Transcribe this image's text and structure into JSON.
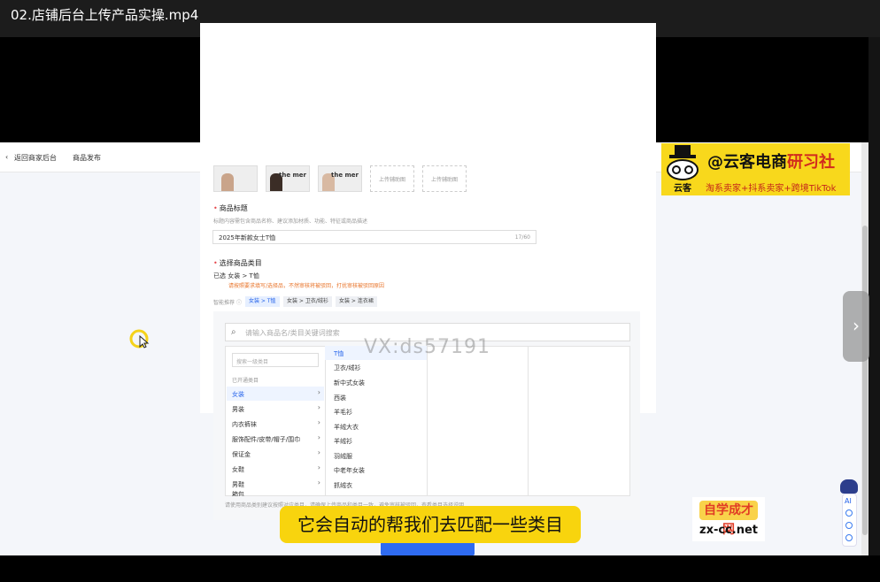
{
  "window": {
    "title": "02.店铺后台上传产品实操.mp4"
  },
  "app_header": {
    "back_label": "返回商家后台",
    "breadcrumb": "商品发布"
  },
  "images": {
    "thumb_texts": [
      "",
      "the\nmer",
      "the\nmer"
    ],
    "upload_labels": [
      "上传辅助图",
      "上传辅助图"
    ]
  },
  "product_title": {
    "label": "商品标题",
    "hint": "标题内容需包含商品名称、建议添加材质、功能、特征或商品描述",
    "value": "2025年新款女士T恤",
    "counter": "17/60"
  },
  "category": {
    "label": "选择商品类目",
    "selected": "已选  女装 > T恤",
    "warning": "请按照要求填写/选择品，不然审核将被驳回，打扰审核被驳回原因",
    "smart_label": "智能推荐",
    "suggestions": [
      "女装 > T恤",
      "女装 > 卫衣/绒衫",
      "女装 > 连衣裙"
    ],
    "search_placeholder": "请输入商品名/类目关键词搜索",
    "level1_search_placeholder": "搜索一级类目",
    "level1_header": "已开通类目",
    "level1": [
      "女装",
      "男装",
      "内衣裤袜",
      "服饰配件/皮带/帽子/围巾",
      "保证金",
      "女鞋",
      "男鞋",
      "箱包"
    ],
    "level2": [
      "T恤",
      "卫衣/绒衫",
      "新中式女装",
      "西装",
      "羊毛衫",
      "羊绒大衣",
      "羊绒衫",
      "羽绒服",
      "中老年女装",
      "抓绒衣"
    ],
    "footer_hint": "请使用商品类别建议按照对应类目，请确保上传商品和类目一致，避免审核被驳回，查看类目选择说明"
  },
  "watermark": "VX:ds57191",
  "logo": {
    "brand_prefix": "@云客电商",
    "brand_suffix": "研习社",
    "sub": "淘系卖家+抖系卖家+跨境TikTok",
    "mascot_text": "云客"
  },
  "caption": "它会自动的帮我们去匹配一些类目",
  "site_logo": {
    "name": "自学成才网",
    "url": "zx-cc.net"
  },
  "side_tools": {
    "ai_label": "AI"
  },
  "nav_arrow": "›",
  "colors": {
    "accent": "#2563eb",
    "caption_bg": "#f8d40e",
    "logo_bg": "#f8d81c",
    "warning": "#e8742a"
  }
}
